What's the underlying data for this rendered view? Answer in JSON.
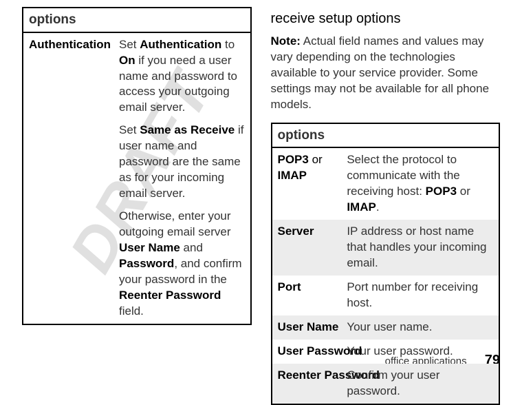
{
  "watermark": "DRAFT",
  "left": {
    "options_header": "options",
    "row_label": "Authentication",
    "p1_a": "Set ",
    "p1_b": "Authentication",
    "p1_c": " to ",
    "p1_d": "On",
    "p1_e": " if you need a user name and password to access your outgoing email server.",
    "p2_a": "Set ",
    "p2_b": "Same as Receive",
    "p2_c": " if user name and password are the same as for your incoming email server.",
    "p3_a": "Otherwise, enter your outgoing email server ",
    "p3_b": "User Name",
    "p3_c": " and ",
    "p3_d": "Password",
    "p3_e": ", and confirm your password in the ",
    "p3_f": "Reenter Password",
    "p3_g": " field."
  },
  "right": {
    "title": "receive setup options",
    "note_label": "Note:",
    "note_text": " Actual field names and values may vary depending on the technologies available to your service provider. Some settings may not be available for all phone models.",
    "options_header": "options",
    "rows": [
      {
        "label_a": "POP3",
        "label_b": " or ",
        "label_c": "IMAP",
        "desc_a": "Select the protocol to communicate with the receiving host: ",
        "desc_b": "POP3",
        "desc_c": " or ",
        "desc_d": "IMAP",
        "desc_e": "."
      },
      {
        "label": "Server",
        "desc": "IP address or host name that handles your incoming email."
      },
      {
        "label": "Port",
        "desc": "Port number for receiving host."
      },
      {
        "label": "User Name",
        "desc": "Your user name."
      },
      {
        "label": "User Password",
        "desc": "Your user password."
      },
      {
        "label": "Reenter Password",
        "desc": "Confirm your user password."
      }
    ]
  },
  "footer": {
    "section": "office applications",
    "page": "79"
  }
}
